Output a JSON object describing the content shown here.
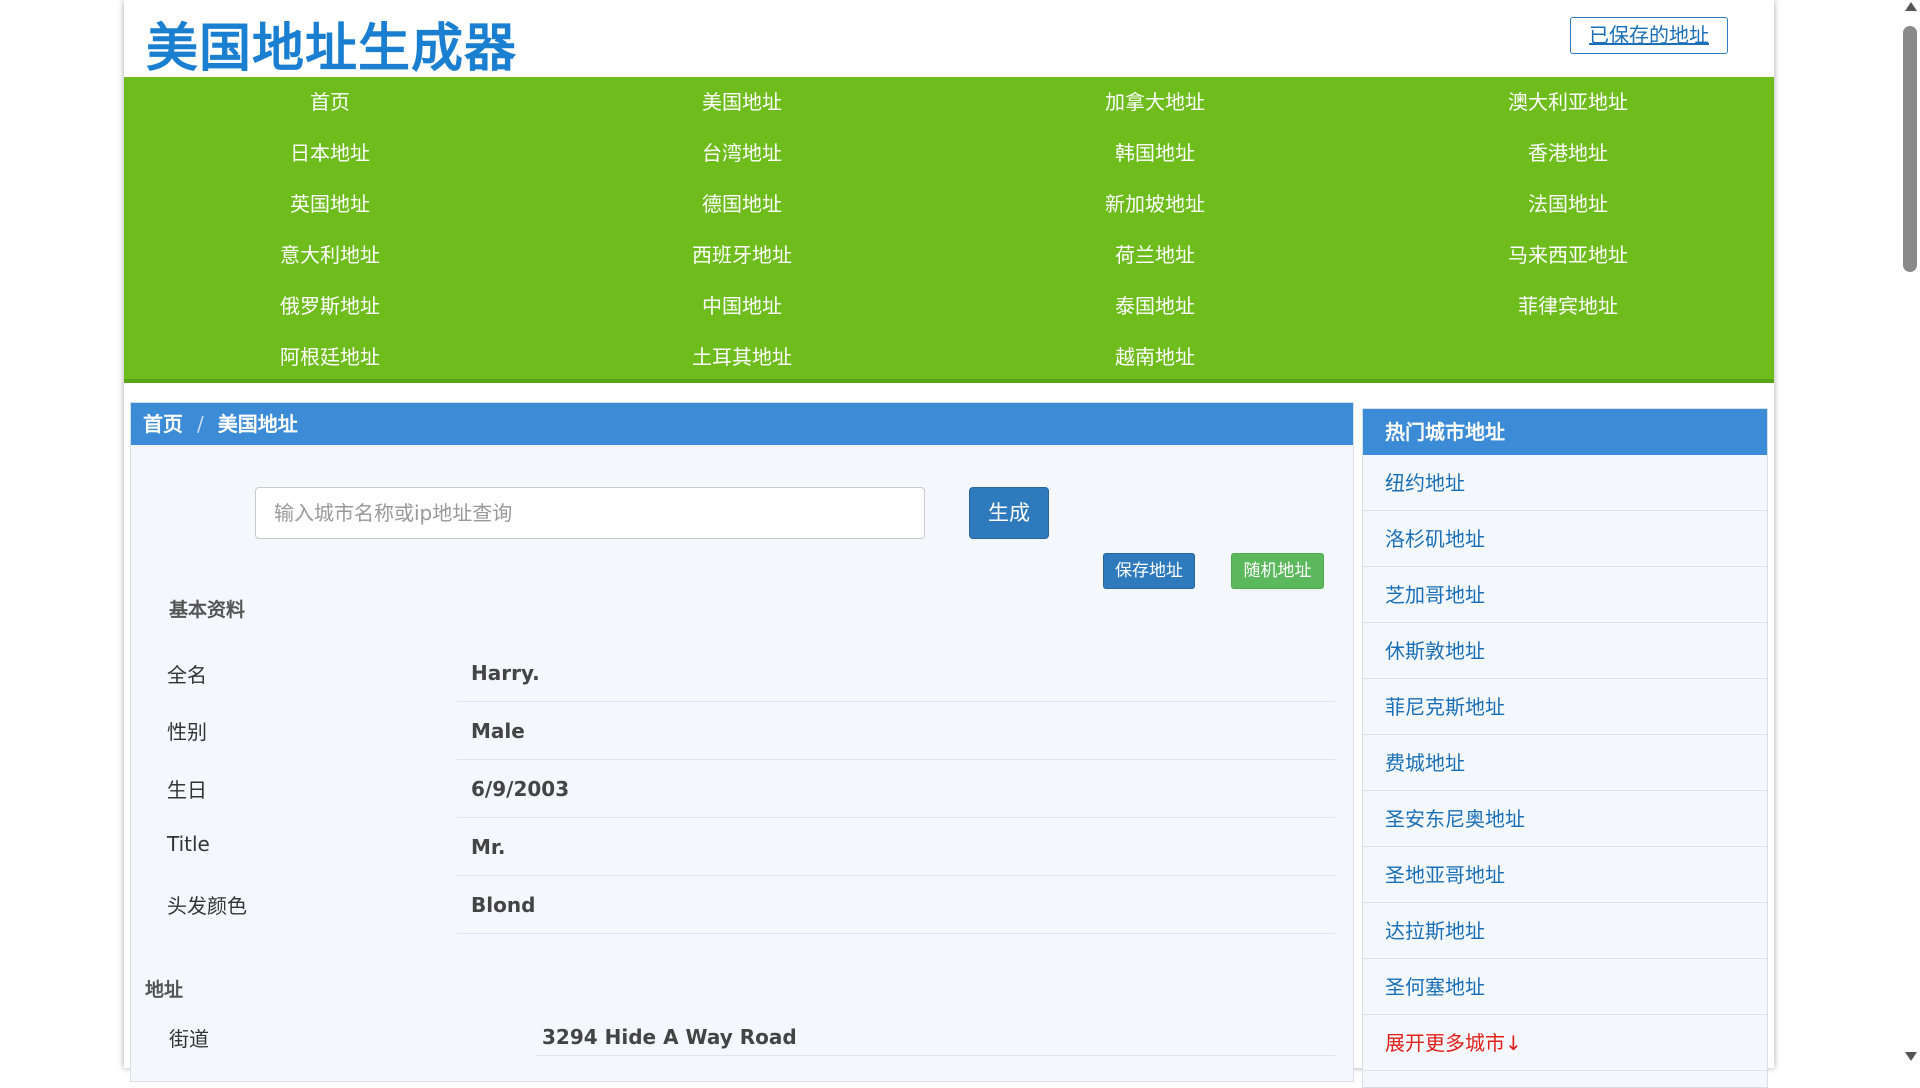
{
  "header": {
    "site_title": "美国地址生成器",
    "saved_link": "已保存的地址"
  },
  "nav": {
    "items": [
      "首页",
      "美国地址",
      "加拿大地址",
      "澳大利亚地址",
      "日本地址",
      "台湾地址",
      "韩国地址",
      "香港地址",
      "英国地址",
      "德国地址",
      "新加坡地址",
      "法国地址",
      "意大利地址",
      "西班牙地址",
      "荷兰地址",
      "马来西亚地址",
      "俄罗斯地址",
      "中国地址",
      "泰国地址",
      "菲律宾地址",
      "阿根廷地址",
      "土耳其地址",
      "越南地址"
    ]
  },
  "breadcrumb": {
    "home": "首页",
    "separator": "/",
    "current": "美国地址"
  },
  "search": {
    "placeholder": "输入城市名称或ip地址查询",
    "generate_label": "生成"
  },
  "actions": {
    "save_label": "保存地址",
    "random_label": "随机地址"
  },
  "basic": {
    "section_title": "基本资料",
    "rows": [
      {
        "label": "全名",
        "value": "Harry."
      },
      {
        "label": "性别",
        "value": "Male"
      },
      {
        "label": "生日",
        "value": "6/9/2003"
      },
      {
        "label": "Title",
        "value": "Mr."
      },
      {
        "label": "头发颜色",
        "value": "Blond"
      }
    ]
  },
  "address": {
    "section_title": "地址",
    "rows": [
      {
        "label": "街道",
        "value": "3294  Hide A Way Road"
      }
    ]
  },
  "sidebar": {
    "title": "热门城市地址",
    "items": [
      "纽约地址",
      "洛杉矶地址",
      "芝加哥地址",
      "休斯敦地址",
      "菲尼克斯地址",
      "费城地址",
      "圣安东尼奥地址",
      "圣地亚哥地址",
      "达拉斯地址",
      "圣何塞地址"
    ],
    "more_label": "展开更多城市↓"
  },
  "colors": {
    "nav_green": "#6ebd1d",
    "accent_blue": "#3b8bd6",
    "link_blue": "#1a6fb8",
    "more_red": "#e0201a"
  }
}
